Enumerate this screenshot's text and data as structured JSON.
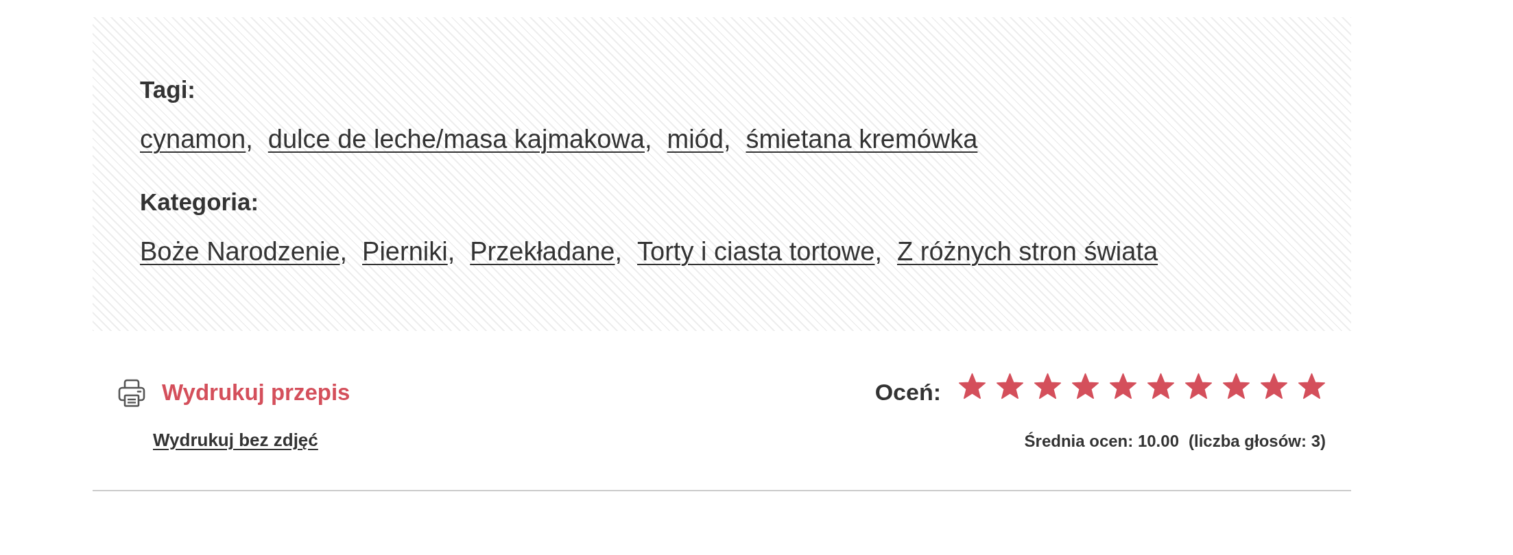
{
  "tags": {
    "label": "Tagi:",
    "separator": ",",
    "items": [
      "cynamon",
      "dulce de leche/masa kajmakowa",
      "miód",
      "śmietana kremówka"
    ]
  },
  "categories": {
    "label": "Kategoria:",
    "separator": ",",
    "items": [
      "Boże Narodzenie",
      "Pierniki",
      "Przekładane",
      "Torty i ciasta tortowe",
      "Z różnych stron świata"
    ]
  },
  "print": {
    "label": "Wydrukuj przepis",
    "without_photos": "Wydrukuj bez zdjęć"
  },
  "rating": {
    "label": "Oceń:",
    "stars": 10,
    "average": "Średnia ocen: 10.00",
    "votes": "(liczba głosów: 3)"
  }
}
